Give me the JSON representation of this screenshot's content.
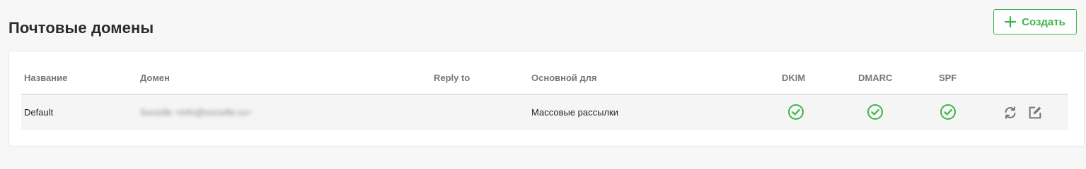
{
  "header": {
    "title": "Почтовые домены",
    "create_button": {
      "label": "Создать",
      "icon": "plus-icon"
    }
  },
  "table": {
    "columns": [
      "Название",
      "Домен",
      "Reply to",
      "Основной для",
      "DKIM",
      "DMARC",
      "SPF"
    ],
    "rows": [
      {
        "name": "Default",
        "domain": "Sociolle <info@sociolle.ru>",
        "reply_to": "",
        "primary_for": "Массовые рассылки",
        "dkim": "check-circle-icon",
        "dmarc": "check-circle-icon",
        "spf": "check-circle-icon",
        "actions": [
          "refresh-icon",
          "edit-icon"
        ]
      }
    ]
  },
  "colors": {
    "accent": "#3bb54a",
    "header_text": "#777777",
    "row_background": "#f5f5f5",
    "page_background": "#f7f7f7"
  }
}
